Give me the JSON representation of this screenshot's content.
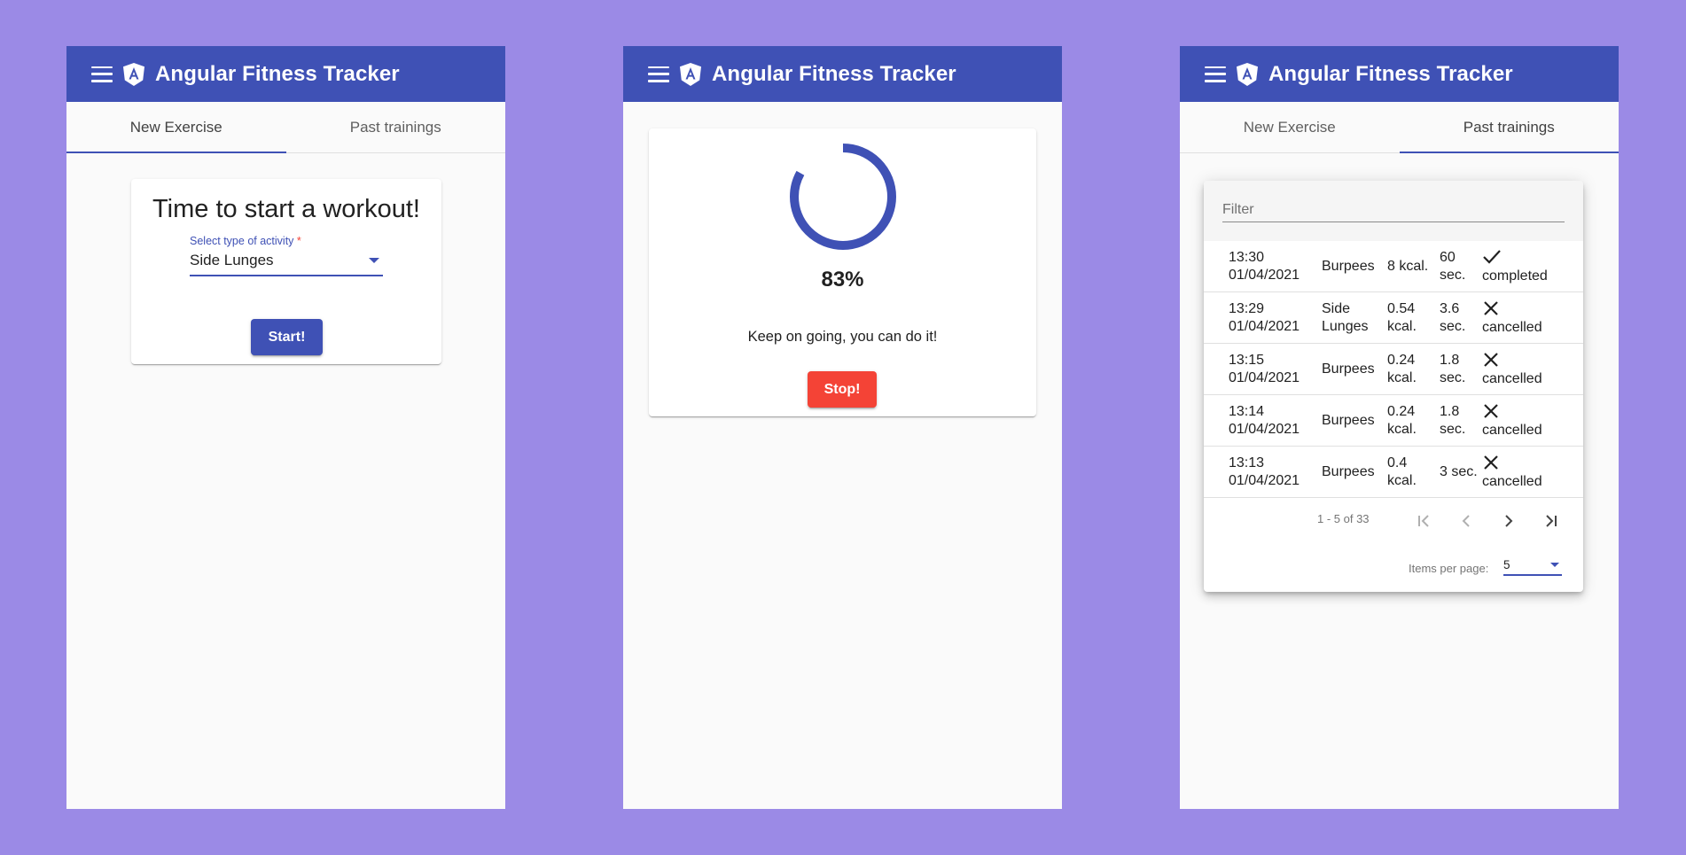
{
  "app": {
    "title": "Angular Fitness Tracker"
  },
  "colors": {
    "primary": "#3f51b5",
    "warn": "#f44336",
    "background": "#9b8ae6"
  },
  "icons": {
    "menu": "menu-icon",
    "logo": "angular-shield-icon"
  },
  "tabs": [
    "New Exercise",
    "Past trainings"
  ],
  "new_exercise": {
    "heading": "Time to start a workout!",
    "select_label": "Select type of activity",
    "required_marker": "*",
    "selected_value": "Side Lunges",
    "start_label": "Start!"
  },
  "current_training": {
    "progress_percent": 83,
    "progress_text": "83%",
    "message": "Keep on going, you can do it!",
    "stop_label": "Stop!"
  },
  "past_trainings": {
    "filter_placeholder": "Filter",
    "rows": [
      {
        "time": "13:30",
        "date": "01/04/2021",
        "name": "Burpees",
        "calories": "8 kcal.",
        "duration": "60 sec.",
        "state_icon": "check-icon",
        "state": "completed"
      },
      {
        "time": "13:29",
        "date": "01/04/2021",
        "name": "Side Lunges",
        "calories": "0.54 kcal.",
        "duration": "3.6 sec.",
        "state_icon": "close-icon",
        "state": "cancelled"
      },
      {
        "time": "13:15",
        "date": "01/04/2021",
        "name": "Burpees",
        "calories": "0.24 kcal.",
        "duration": "1.8 sec.",
        "state_icon": "close-icon",
        "state": "cancelled"
      },
      {
        "time": "13:14",
        "date": "01/04/2021",
        "name": "Burpees",
        "calories": "0.24 kcal.",
        "duration": "1.8 sec.",
        "state_icon": "close-icon",
        "state": "cancelled"
      },
      {
        "time": "13:13",
        "date": "01/04/2021",
        "name": "Burpees",
        "calories": "0.4 kcal.",
        "duration": "3 sec.",
        "state_icon": "close-icon",
        "state": "cancelled"
      }
    ],
    "paginator": {
      "range_label": "1 - 5 of 33",
      "items_per_page_label": "Items per page:",
      "page_size": "5"
    }
  }
}
